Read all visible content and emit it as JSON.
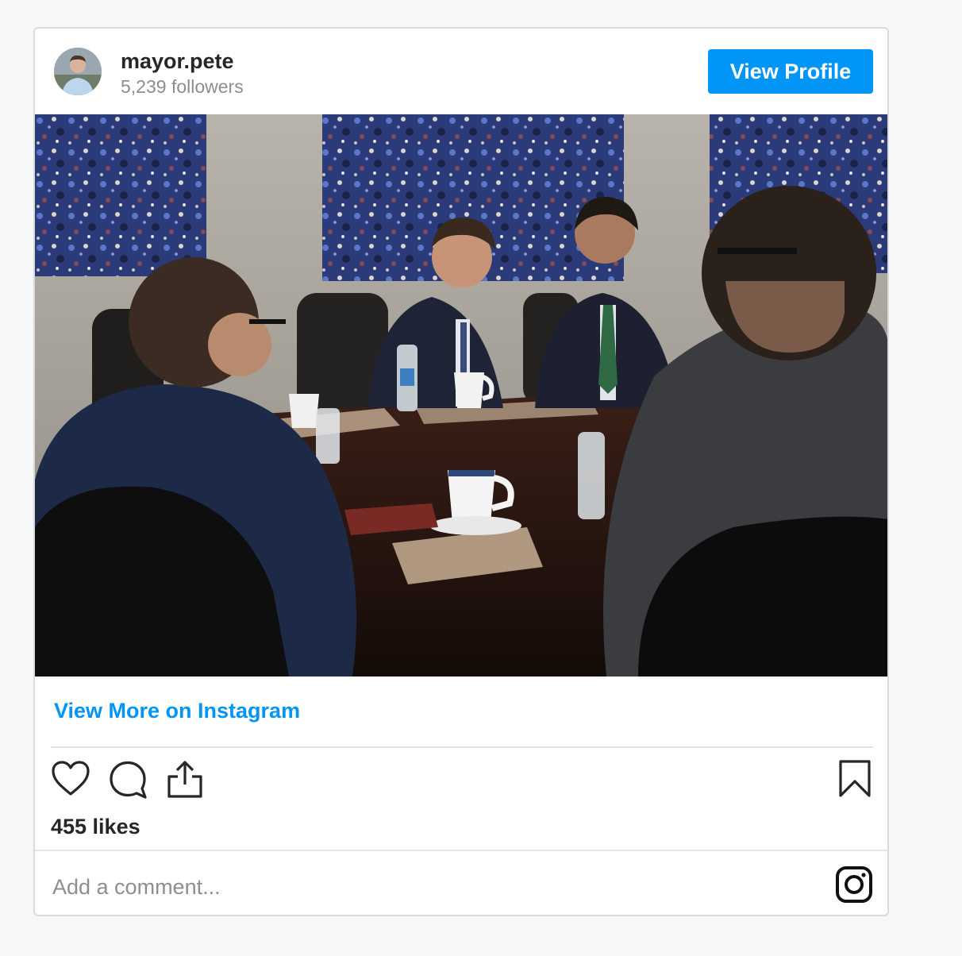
{
  "profile": {
    "username": "mayor.pete",
    "followers": "5,239 followers",
    "view_profile_label": "View Profile"
  },
  "post": {
    "view_more_label": "View More on Instagram",
    "likes": "455 likes",
    "comment_placeholder": "Add a comment..."
  },
  "icons": {
    "like": "heart-icon",
    "comment": "comment-icon",
    "share": "share-icon",
    "save": "bookmark-icon",
    "brand": "instagram-icon"
  },
  "colors": {
    "accent": "#0095f6",
    "text": "#262626",
    "muted": "#8e8e8e"
  }
}
